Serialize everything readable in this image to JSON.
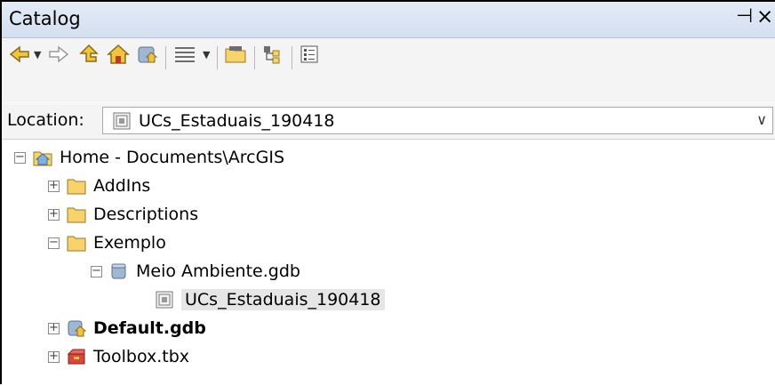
{
  "window": {
    "title": "Catalog",
    "pin_symbol": "⊣",
    "close_symbol": "×"
  },
  "toolbar": {
    "buttons": [
      "back-icon",
      "forward-icon",
      "up-one-level-icon",
      "home-icon",
      "default-geodatabase-icon",
      "view-menu-icon",
      "connect-folder-icon",
      "toggle-contents-icon",
      "options-icon"
    ]
  },
  "location": {
    "label": "Location:",
    "value": "UCs_Estaduais_190418"
  },
  "tree": {
    "home": {
      "label": "Home - Documents\\ArcGIS",
      "state": "−"
    },
    "addins": {
      "label": "AddIns",
      "state": "+"
    },
    "descriptions": {
      "label": "Descriptions",
      "state": "+"
    },
    "exemplo": {
      "label": "Exemplo",
      "state": "−"
    },
    "gdb": {
      "label": "Meio Ambiente.gdb",
      "state": "−"
    },
    "feature": {
      "label": "UCs_Estaduais_190418"
    },
    "default_gdb": {
      "label": "Default.gdb",
      "state": "+"
    },
    "toolbox": {
      "label": "Toolbox.tbx",
      "state": "+"
    }
  },
  "colors": {
    "title_bg": "#dbe5f3",
    "folder": "#f6d36b",
    "selected_row": "#e6e6e6"
  }
}
